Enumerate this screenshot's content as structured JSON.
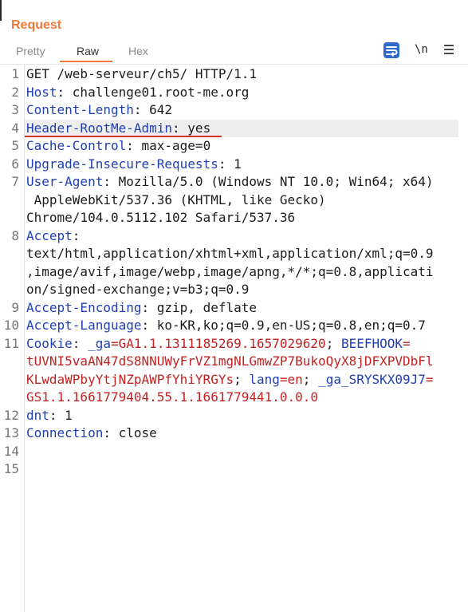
{
  "title": "Request",
  "tabs": {
    "pretty": "Pretty",
    "raw": "Raw",
    "hex": "Hex",
    "active": "Raw"
  },
  "toolbar": {
    "newline_label": "\\n"
  },
  "colors": {
    "accent": "#f2783a",
    "header_name": "#1f3fb5",
    "cookie_value": "#c22222",
    "underline": "#d6312a"
  },
  "lines": [
    {
      "n": "1",
      "text": "GET /web-serveur/ch5/ HTTP/1.1"
    },
    {
      "n": "2",
      "name": "Host",
      "value": ": challenge01.root-me.org"
    },
    {
      "n": "3",
      "name": "Content-Length",
      "value": ": 642"
    },
    {
      "n": "4",
      "name": "Header-RootMe-Admin",
      "value": ": yes"
    },
    {
      "n": "5",
      "name": "Cache-Control",
      "value": ": max-age=0"
    },
    {
      "n": "6",
      "name": "Upgrade-Insecure-Requests",
      "value": ": 1"
    },
    {
      "n": "7",
      "name": "User-Agent",
      "value": ": Mozilla/5.0 (Windows NT 10.0; Win64; x64)"
    },
    {
      "n": "",
      "text": " AppleWebKit/537.36 (KHTML, like Gecko)"
    },
    {
      "n": "",
      "text": "Chrome/104.0.5112.102 Safari/537.36"
    },
    {
      "n": "8",
      "name": "Accept",
      "value": ":"
    },
    {
      "n": "",
      "text": "text/html,application/xhtml+xml,application/xml;q=0.9"
    },
    {
      "n": "",
      "text": ",image/avif,image/webp,image/apng,*/*;q=0.8,applicati"
    },
    {
      "n": "",
      "text": "on/signed-exchange;v=b3;q=0.9"
    },
    {
      "n": "9",
      "name": "Accept-Encoding",
      "value": ": gzip, deflate"
    },
    {
      "n": "10",
      "name": "Accept-Language",
      "value": ": ko-KR,ko;q=0.9,en-US;q=0.8,en;q=0.7"
    },
    {
      "n": "11",
      "name": "Cookie",
      "c1": ": ",
      "k1": "_ga",
      "v1": "=GA1.1.1311185269.1657029620",
      "s1": "; ",
      "k2": "BEEFHOOK",
      "v2": "="
    },
    {
      "n": "",
      "red": "tUVNI5vaAN47dS8NNUWyFrVZ1mgNLGmwZP7BukoQyX8jDFXPVDbFl"
    },
    {
      "n": "",
      "red": "KLwdaWPbyYtjNZpAWPfYhiYRGYs",
      "s2": "; ",
      "k3": "lang",
      "v3": "=en",
      "s3": "; ",
      "k4": "_ga_SRYSKX09J7",
      "v4": "="
    },
    {
      "n": "",
      "red": "GS1.1.1661779404.55.1.1661779441.0.0.0"
    },
    {
      "n": "12",
      "name": "dnt",
      "value": ": 1"
    },
    {
      "n": "13",
      "name": "Connection",
      "value": ": close"
    },
    {
      "n": "14",
      "text": ""
    },
    {
      "n": "15",
      "text": ""
    }
  ]
}
